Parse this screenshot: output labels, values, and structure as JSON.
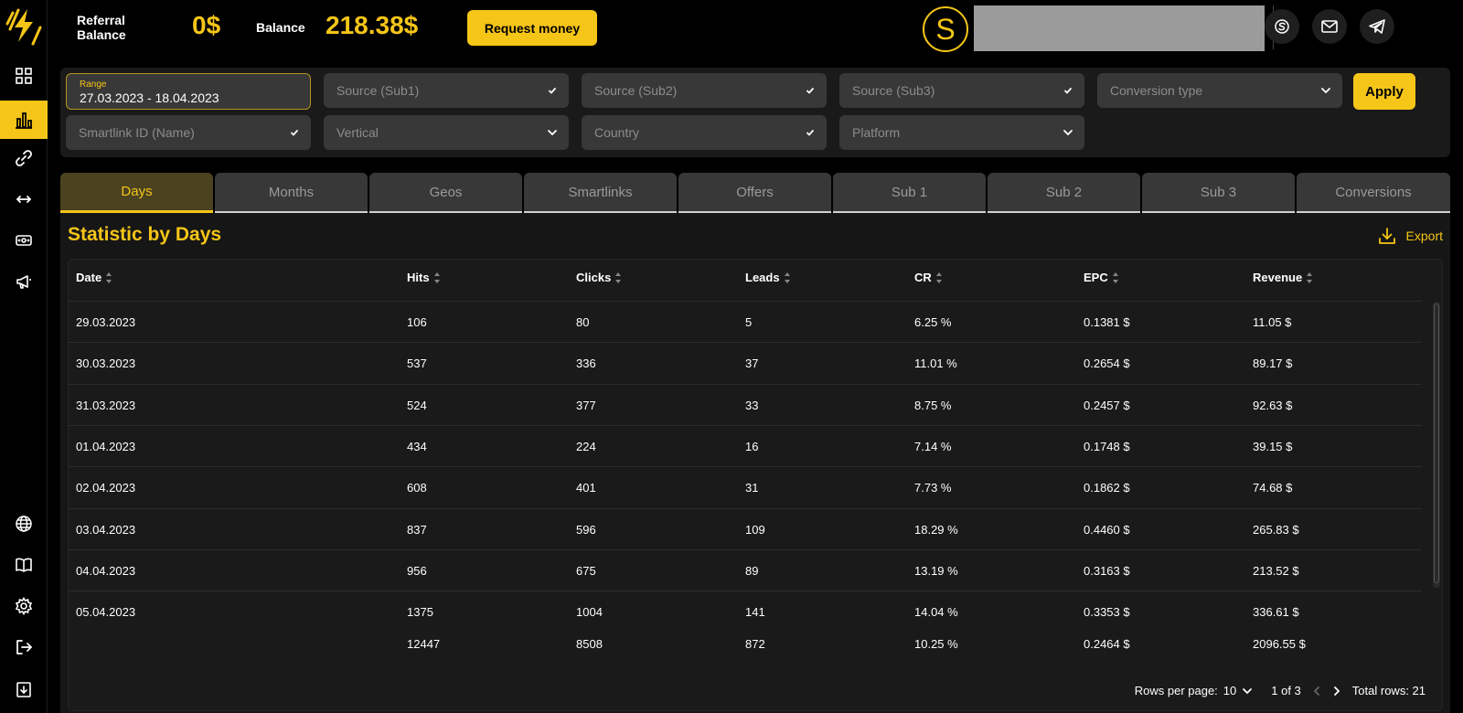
{
  "header": {
    "referral_label": "Referral Balance",
    "referral_value": "0$",
    "balance_label": "Balance",
    "balance_value": "218.38$",
    "request_button": "Request money",
    "avatar_letter": "S"
  },
  "sidebar": {
    "icons": [
      "dashboard-icon",
      "statistics-icon",
      "link-icon",
      "arrows-icon",
      "payment-icon",
      "megaphone-icon",
      "globe-icon",
      "book-icon",
      "gear-icon",
      "logout-icon",
      "download-icon"
    ],
    "active": "statistics-icon"
  },
  "filters": {
    "range_label": "Range",
    "range_value": "27.03.2023 - 18.04.2023",
    "source_sub1": "Source (Sub1)",
    "source_sub2": "Source (Sub2)",
    "source_sub3": "Source (Sub3)",
    "conversion_type": "Conversion type",
    "smartlink_id": "Smartlink ID (Name)",
    "vertical": "Vertical",
    "country": "Country",
    "platform": "Platform",
    "apply": "Apply"
  },
  "tabs": [
    "Days",
    "Months",
    "Geos",
    "Smartlinks",
    "Offers",
    "Sub 1",
    "Sub 2",
    "Sub 3",
    "Conversions"
  ],
  "active_tab": "Days",
  "section": {
    "title": "Statistic by Days",
    "export": "Export"
  },
  "table": {
    "columns": [
      "Date",
      "Hits",
      "Clicks",
      "Leads",
      "CR",
      "EPC",
      "Revenue"
    ],
    "rows": [
      [
        "29.03.2023",
        "106",
        "80",
        "5",
        "6.25 %",
        "0.1381 $",
        "11.05 $"
      ],
      [
        "30.03.2023",
        "537",
        "336",
        "37",
        "11.01 %",
        "0.2654 $",
        "89.17 $"
      ],
      [
        "31.03.2023",
        "524",
        "377",
        "33",
        "8.75 %",
        "0.2457 $",
        "92.63 $"
      ],
      [
        "01.04.2023",
        "434",
        "224",
        "16",
        "7.14 %",
        "0.1748 $",
        "39.15 $"
      ],
      [
        "02.04.2023",
        "608",
        "401",
        "31",
        "7.73 %",
        "0.1862 $",
        "74.68 $"
      ],
      [
        "03.04.2023",
        "837",
        "596",
        "109",
        "18.29 %",
        "0.4460 $",
        "265.83 $"
      ],
      [
        "04.04.2023",
        "956",
        "675",
        "89",
        "13.19 %",
        "0.3163 $",
        "213.52 $"
      ],
      [
        "05.04.2023",
        "1375",
        "1004",
        "141",
        "14.04 %",
        "0.3353 $",
        "336.61 $"
      ]
    ],
    "totals": [
      "",
      "12447",
      "8508",
      "872",
      "10.25 %",
      "0.2464 $",
      "2096.55 $"
    ]
  },
  "footer": {
    "rows_per_page_label": "Rows per page:",
    "rows_per_page_value": "10",
    "page_info": "1 of 3",
    "total_rows": "Total rows: 21"
  },
  "colors": {
    "accent": "#f5c518",
    "background": "#000000",
    "panel": "#1a1a1a"
  }
}
